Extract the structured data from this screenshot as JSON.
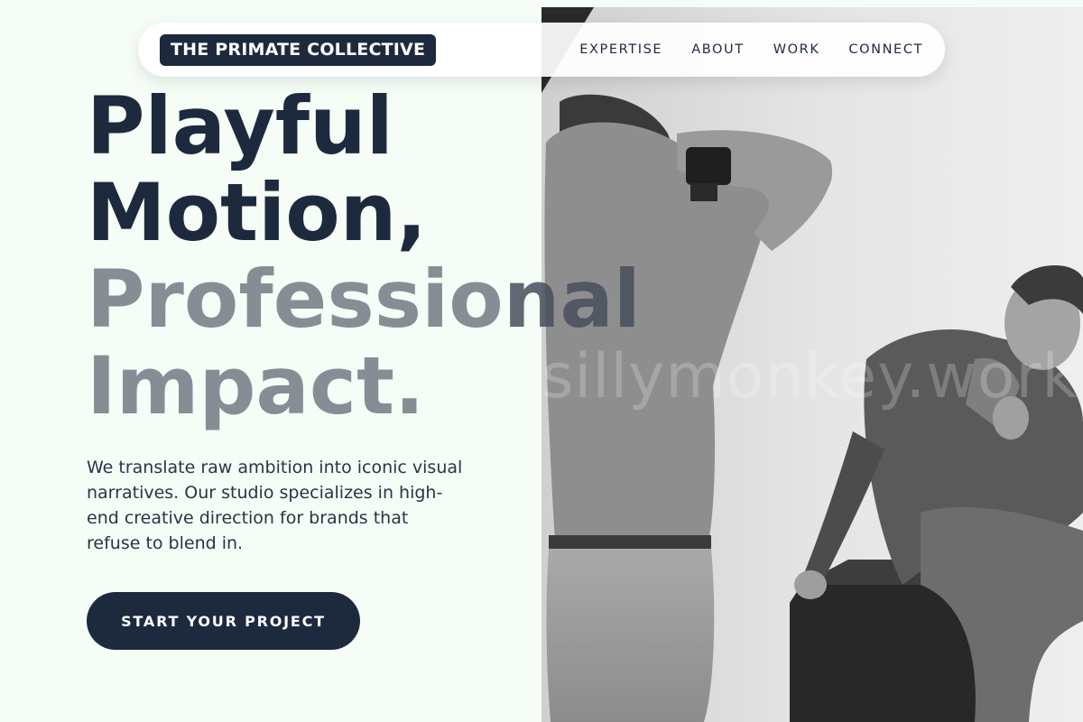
{
  "nav": {
    "logo": "THE PRIMATE COLLECTIVE",
    "links": [
      "EXPERTISE",
      "ABOUT",
      "WORK",
      "CONNECT"
    ]
  },
  "hero": {
    "line1": "Playful",
    "line2": "Motion,",
    "line3a": "Professio",
    "line3b": "nal",
    "line4": "Impact.",
    "description": "We translate raw ambition into iconic visual narratives. Our studio specializes in high-end creative direction for brands that refuse to blend in.",
    "cta": "START YOUR PROJECT"
  },
  "watermark": "sillymonkey.work",
  "colors": {
    "background": "#f5fdf6",
    "primary": "#1d2a3e",
    "muted": "#878d94"
  }
}
